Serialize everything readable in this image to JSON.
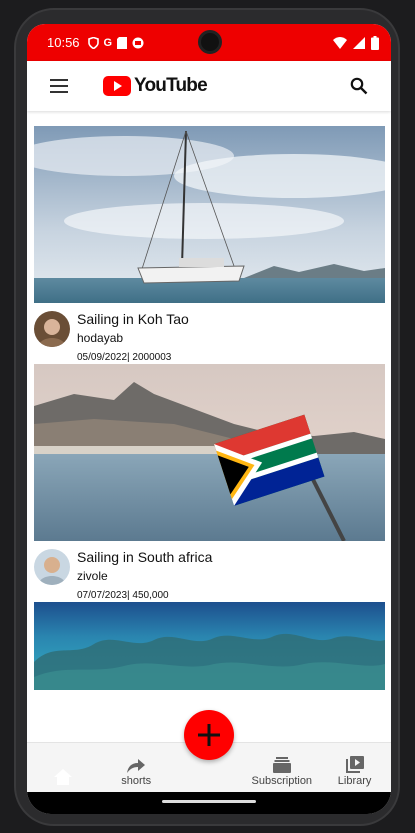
{
  "status_bar": {
    "time": "10:56",
    "icons_left": [
      "shield-icon",
      "google-icon",
      "sd-card-icon",
      "robot-icon"
    ],
    "icons_right": [
      "wifi-icon",
      "signal-icon",
      "battery-icon"
    ]
  },
  "app_bar": {
    "logo_text": "YouTube",
    "menu_icon": "hamburger-icon",
    "search_icon": "search-icon"
  },
  "videos": [
    {
      "title": "Sailing in Koh Tao",
      "channel": "hodayab",
      "stats": "05/09/2022| 2000003",
      "thumbnail": "sailboat-sea"
    },
    {
      "title": "Sailing in South africa",
      "channel": "zivole",
      "stats": "07/07/2023| 450,000",
      "thumbnail": "south-africa-flag-harbor"
    },
    {
      "title": "",
      "channel": "",
      "stats": "",
      "thumbnail": "underwater-reef"
    }
  ],
  "fab": {
    "icon": "plus-icon"
  },
  "bottom_nav": [
    {
      "label": "",
      "icon": "home-icon"
    },
    {
      "label": "shorts",
      "icon": "share-arrow-icon"
    },
    {
      "label": "",
      "icon": ""
    },
    {
      "label": "Subscription",
      "icon": "subscriptions-icon"
    },
    {
      "label": "Library",
      "icon": "library-icon"
    }
  ],
  "colors": {
    "brand_red": "#ff0000",
    "status_red": "#ee0000"
  }
}
